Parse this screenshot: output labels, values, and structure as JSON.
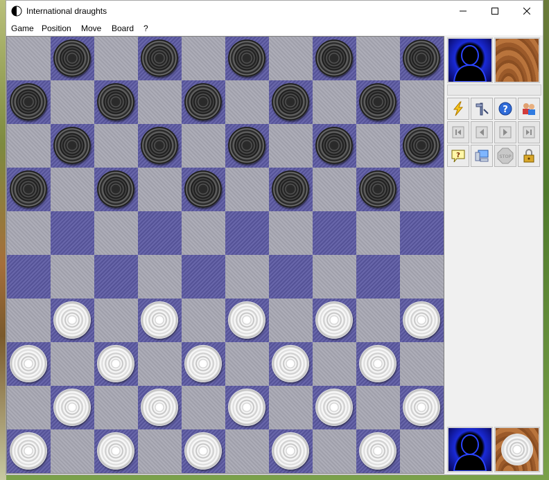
{
  "window": {
    "title": "International draughts",
    "controls": [
      "minimize-icon",
      "maximize-icon",
      "close-icon"
    ]
  },
  "menu": {
    "items": [
      "Game",
      "Position",
      "Move",
      "Board",
      "?"
    ]
  },
  "board": {
    "size": 10,
    "light_color": "#a8a8b4",
    "dark_color": "#5c5aa4",
    "black_rows": [
      0,
      1,
      2,
      3
    ],
    "white_rows": [
      6,
      7,
      8,
      9
    ]
  },
  "side_panel": {
    "top_player": {
      "avatar": "silhouette-icon",
      "piece": "wood-tile-icon"
    },
    "bottom_player": {
      "avatar": "silhouette-icon",
      "piece": "white-piece-icon"
    },
    "toolbar_rows": [
      [
        "lightning-icon",
        "tools-icon",
        "help-icon",
        "players-icon"
      ],
      [
        "first-move-icon",
        "previous-move-icon",
        "next-move-icon",
        "last-move-icon"
      ],
      [
        "hint-icon",
        "computer-icon",
        "stop-icon",
        "lock-icon"
      ]
    ],
    "stop_label": "STOP"
  },
  "colors": {
    "accent_blue": "#1a2bd8",
    "wood": "#a4652f"
  }
}
